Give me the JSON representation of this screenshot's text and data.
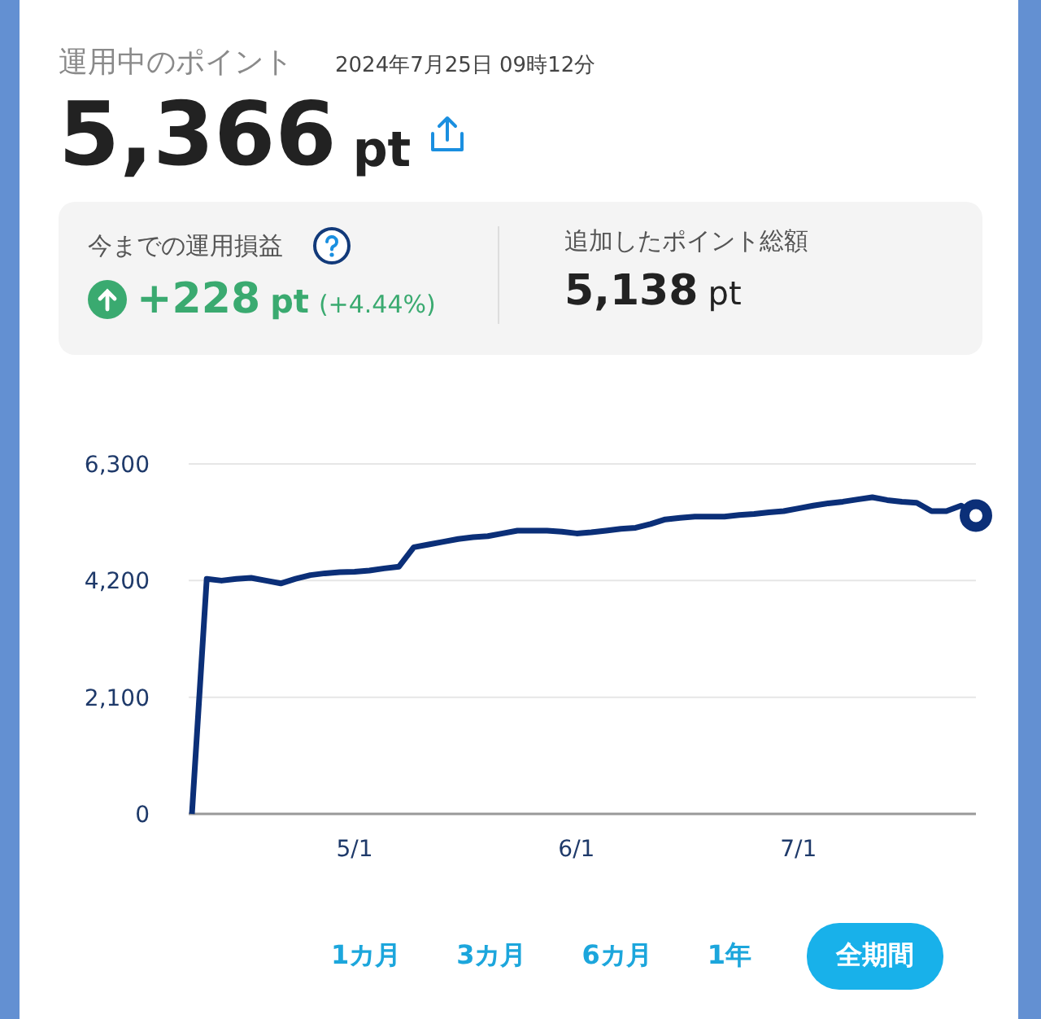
{
  "header": {
    "title": "運用中のポイント",
    "timestamp": "2024年7月25日 09時12分"
  },
  "balance": {
    "value": "5,366",
    "unit": "pt"
  },
  "summary": {
    "profit": {
      "label": "今までの運用損益",
      "rising": true,
      "value": "+228",
      "unit": "pt",
      "percent": "(+4.44%)"
    },
    "added": {
      "label": "追加したポイント総額",
      "value": "5,138",
      "unit": "pt"
    }
  },
  "chart": {
    "chart_data": {
      "type": "line",
      "categories": [
        null,
        null,
        null,
        null,
        null,
        null,
        null,
        null,
        null,
        null,
        null,
        "5/1",
        null,
        null,
        null,
        null,
        null,
        null,
        null,
        null,
        null,
        null,
        null,
        null,
        null,
        null,
        "6/1",
        null,
        null,
        null,
        null,
        null,
        null,
        null,
        null,
        null,
        null,
        null,
        null,
        null,
        null,
        "7/1",
        null,
        null,
        null,
        null,
        null,
        null,
        null,
        null,
        null,
        null,
        null,
        null
      ],
      "series": [
        {
          "color": "#0b2f78",
          "values": [
            0,
            4230,
            4200,
            4230,
            4250,
            4200,
            4150,
            4230,
            4300,
            4330,
            4350,
            4360,
            4380,
            4420,
            4450,
            4800,
            4850,
            4900,
            4950,
            4980,
            5000,
            5050,
            5100,
            5100,
            5100,
            5080,
            5050,
            5070,
            5100,
            5130,
            5150,
            5220,
            5300,
            5330,
            5350,
            5350,
            5350,
            5380,
            5400,
            5430,
            5450,
            5500,
            5550,
            5590,
            5620,
            5660,
            5700,
            5650,
            5620,
            5600,
            5450,
            5450,
            5550,
            5370
          ]
        }
      ],
      "ylim": [
        0,
        6300
      ],
      "yticks": [
        {
          "value": 0,
          "label": "0"
        },
        {
          "value": 2100,
          "label": "2,100"
        },
        {
          "value": 4200,
          "label": "4,200"
        },
        {
          "value": 6300,
          "label": "6,300"
        }
      ]
    }
  },
  "periods": [
    {
      "label": "1カ月",
      "selected": false
    },
    {
      "label": "3カ月",
      "selected": false
    },
    {
      "label": "6カ月",
      "selected": false
    },
    {
      "label": "1年",
      "selected": false
    },
    {
      "label": "全期間",
      "selected": true
    }
  ]
}
